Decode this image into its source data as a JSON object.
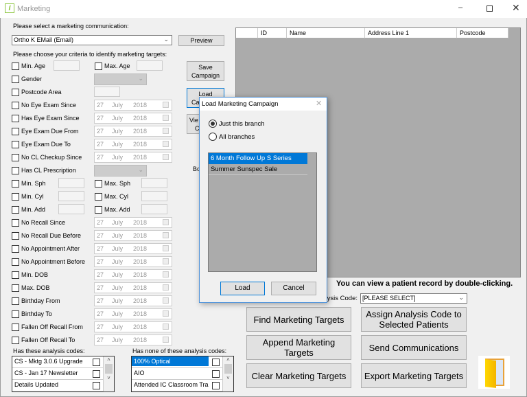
{
  "window": {
    "title": "Marketing",
    "controls": [
      "minimize",
      "maximize",
      "close"
    ]
  },
  "communication": {
    "label": "Please select a marketing communication:",
    "value": "Ortho K EMail (Email)",
    "preview": "Preview"
  },
  "criteria_label": "Please choose your criteria to identify marketing targets:",
  "criteria": [
    {
      "label": "Min. Age",
      "kind": "text",
      "right": {
        "label": "Max. Age"
      }
    },
    {
      "label": "Gender",
      "kind": "combo"
    },
    {
      "label": "Postcode Area",
      "kind": "text2"
    },
    {
      "label": "No Eye Exam Since",
      "kind": "date"
    },
    {
      "label": "Has Eye Exam Since",
      "kind": "date"
    },
    {
      "label": "Eye Exam Due From",
      "kind": "date"
    },
    {
      "label": "Eye Exam Due To",
      "kind": "date"
    },
    {
      "label": "No CL Checkup Since",
      "kind": "date"
    },
    {
      "label": "Has CL Prescription",
      "kind": "combo"
    },
    {
      "label": "Min. Sph",
      "kind": "text",
      "right": {
        "label": "Max. Sph"
      }
    },
    {
      "label": "Min. Cyl",
      "kind": "text",
      "right": {
        "label": "Max. Cyl"
      }
    },
    {
      "label": "Min. Add",
      "kind": "text",
      "right": {
        "label": "Max. Add"
      }
    },
    {
      "label": "No Recall Since",
      "kind": "date"
    },
    {
      "label": "No Recall Due Before",
      "kind": "date"
    },
    {
      "label": "No Appointment After",
      "kind": "date"
    },
    {
      "label": "No Appointment Before",
      "kind": "date"
    },
    {
      "label": "Min. DOB",
      "kind": "date"
    },
    {
      "label": "Max. DOB",
      "kind": "date"
    },
    {
      "label": "Birthday From",
      "kind": "date"
    },
    {
      "label": "Birthday To",
      "kind": "date"
    },
    {
      "label": "Fallen Off Recall From",
      "kind": "date"
    },
    {
      "label": "Fallen Off Recall To",
      "kind": "date"
    }
  ],
  "date_default": {
    "day": "27",
    "month": "July",
    "year": "2018"
  },
  "side_buttons": {
    "save": [
      "Save",
      "Campaign"
    ],
    "load": [
      "Load",
      "Campaign"
    ],
    "view": [
      "Vie",
      "C"
    ],
    "bo_text": "Bo"
  },
  "grid": {
    "columns": [
      "",
      "ID",
      "Name",
      "Address Line 1",
      "Postcode"
    ]
  },
  "hint": "You can view a patient record by double-clicking.",
  "analysis": {
    "label": "Analysis Code:",
    "value": "[PLEASE SELECT]"
  },
  "buttons": {
    "find": "Find Marketing Targets",
    "assign": "Assign Analysis Code to Selected Patients",
    "append": "Append Marketing Targets",
    "send": "Send Communications",
    "clear": "Clear Marketing Targets",
    "export": "Export Marketing Targets"
  },
  "has_codes": {
    "label": "Has these analysis codes:",
    "items": [
      "CS  - Mktg 3.0.6 Upgrade",
      "CS - Jan 17 Newsletter",
      "Details Updated"
    ]
  },
  "none_codes": {
    "label": "Has none of these analysis codes:",
    "items": [
      "100% Optical",
      "AIO",
      "Attended IC Classroom Traini..."
    ]
  },
  "dialog": {
    "title": "Load Marketing Campaign",
    "radios": [
      "Just this branch",
      "All branches"
    ],
    "selected_radio": 0,
    "campaigns": [
      "6 Month Follow Up S Series",
      "Summer Sunspec Sale"
    ],
    "selected_campaign": 0,
    "load": "Load",
    "cancel": "Cancel"
  },
  "colors": {
    "selection": "#0078d7",
    "grid_bg": "#ababab"
  }
}
